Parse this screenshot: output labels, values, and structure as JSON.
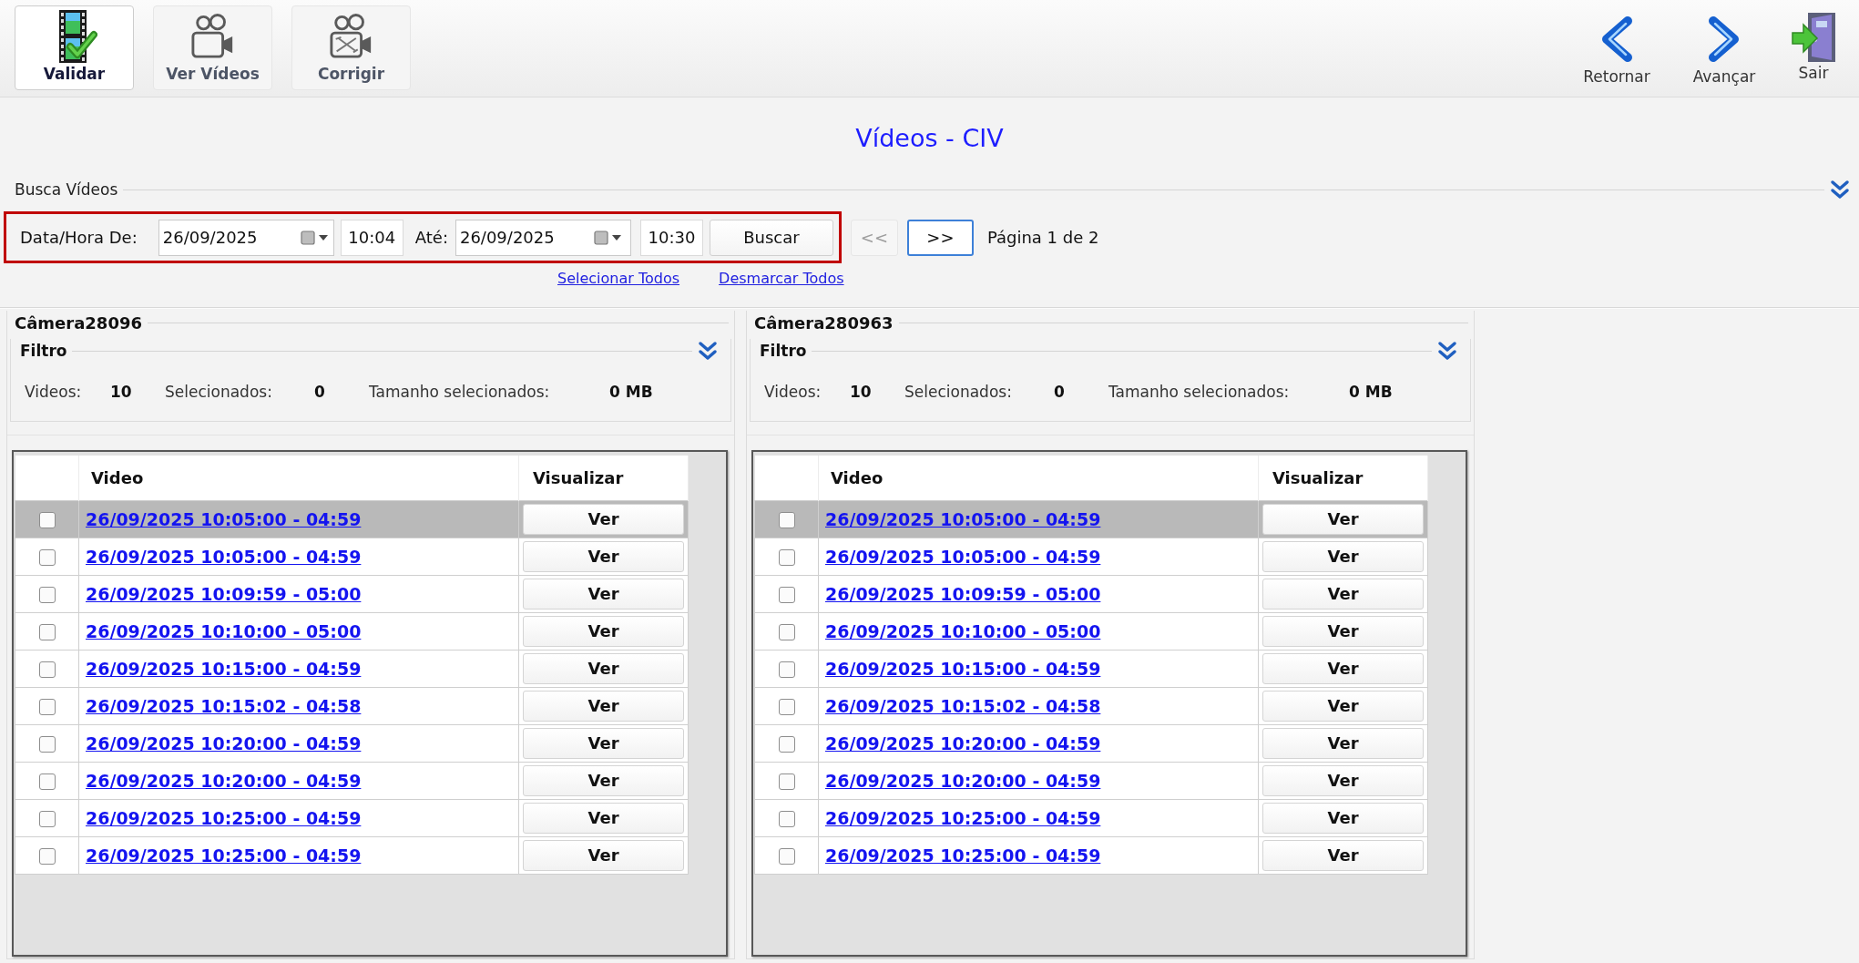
{
  "toolbar": {
    "left_buttons": [
      {
        "kind": "validate",
        "label": "Validar",
        "selected": true
      },
      {
        "kind": "view",
        "label": "Ver Vídeos",
        "selected": false
      },
      {
        "kind": "fix",
        "label": "Corrigir",
        "selected": false
      }
    ],
    "right_buttons": [
      {
        "kind": "back",
        "label": "Retornar"
      },
      {
        "kind": "forward",
        "label": "Avançar"
      },
      {
        "kind": "exit",
        "label": "Sair"
      }
    ]
  },
  "title": "Vídeos - CIV",
  "search": {
    "group_label": "Busca Vídeos",
    "highlighted": true,
    "from_label": "Data/Hora De:",
    "from_date": "26/09/2025",
    "from_time": "10:04",
    "to_label": "Até:",
    "to_date": "26/09/2025",
    "to_time": "10:30",
    "search_button": "Buscar"
  },
  "pager": {
    "prev": {
      "label": "<<",
      "disabled": true,
      "focused": false
    },
    "next": {
      "label": ">>",
      "disabled": false,
      "focused": true
    },
    "page_info": "Página 1 de 2"
  },
  "links": {
    "select_all": "Selecionar Todos",
    "deselect_all": "Desmarcar Todos"
  },
  "cameras": [
    {
      "name": "Câmera28096",
      "filter": {
        "label": "Filtro",
        "stats": [
          {
            "label": "Videos:",
            "value": "10"
          },
          {
            "label": "Selecionados:",
            "value": "0"
          },
          {
            "label": "Tamanho selecionados:",
            "value": "0 MB"
          }
        ]
      },
      "table": {
        "columns": [
          "Video",
          "Visualizar"
        ],
        "rows": [
          {
            "selected": true,
            "checked": false,
            "video": "26/09/2025 10:05:00 - 04:59",
            "action": "Ver"
          },
          {
            "selected": false,
            "checked": false,
            "video": "26/09/2025 10:05:00 - 04:59",
            "action": "Ver"
          },
          {
            "selected": false,
            "checked": false,
            "video": "26/09/2025 10:09:59 - 05:00",
            "action": "Ver"
          },
          {
            "selected": false,
            "checked": false,
            "video": "26/09/2025 10:10:00 - 05:00",
            "action": "Ver"
          },
          {
            "selected": false,
            "checked": false,
            "video": "26/09/2025 10:15:00 - 04:59",
            "action": "Ver"
          },
          {
            "selected": false,
            "checked": false,
            "video": "26/09/2025 10:15:02 - 04:58",
            "action": "Ver"
          },
          {
            "selected": false,
            "checked": false,
            "video": "26/09/2025 10:20:00 - 04:59",
            "action": "Ver"
          },
          {
            "selected": false,
            "checked": false,
            "video": "26/09/2025 10:20:00 - 04:59",
            "action": "Ver"
          },
          {
            "selected": false,
            "checked": false,
            "video": "26/09/2025 10:25:00 - 04:59",
            "action": "Ver"
          },
          {
            "selected": false,
            "checked": false,
            "video": "26/09/2025 10:25:00 - 04:59",
            "action": "Ver"
          }
        ]
      }
    },
    {
      "name": "Câmera280963",
      "filter": {
        "label": "Filtro",
        "stats": [
          {
            "label": "Videos:",
            "value": "10"
          },
          {
            "label": "Selecionados:",
            "value": "0"
          },
          {
            "label": "Tamanho selecionados:",
            "value": "0 MB"
          }
        ]
      },
      "table": {
        "columns": [
          "Video",
          "Visualizar"
        ],
        "rows": [
          {
            "selected": true,
            "checked": false,
            "video": "26/09/2025 10:05:00 - 04:59",
            "action": "Ver"
          },
          {
            "selected": false,
            "checked": false,
            "video": "26/09/2025 10:05:00 - 04:59",
            "action": "Ver"
          },
          {
            "selected": false,
            "checked": false,
            "video": "26/09/2025 10:09:59 - 05:00",
            "action": "Ver"
          },
          {
            "selected": false,
            "checked": false,
            "video": "26/09/2025 10:10:00 - 05:00",
            "action": "Ver"
          },
          {
            "selected": false,
            "checked": false,
            "video": "26/09/2025 10:15:00 - 04:59",
            "action": "Ver"
          },
          {
            "selected": false,
            "checked": false,
            "video": "26/09/2025 10:15:02 - 04:58",
            "action": "Ver"
          },
          {
            "selected": false,
            "checked": false,
            "video": "26/09/2025 10:20:00 - 04:59",
            "action": "Ver"
          },
          {
            "selected": false,
            "checked": false,
            "video": "26/09/2025 10:20:00 - 04:59",
            "action": "Ver"
          },
          {
            "selected": false,
            "checked": false,
            "video": "26/09/2025 10:25:00 - 04:59",
            "action": "Ver"
          },
          {
            "selected": false,
            "checked": false,
            "video": "26/09/2025 10:25:00 - 04:59",
            "action": "Ver"
          }
        ]
      }
    }
  ]
}
